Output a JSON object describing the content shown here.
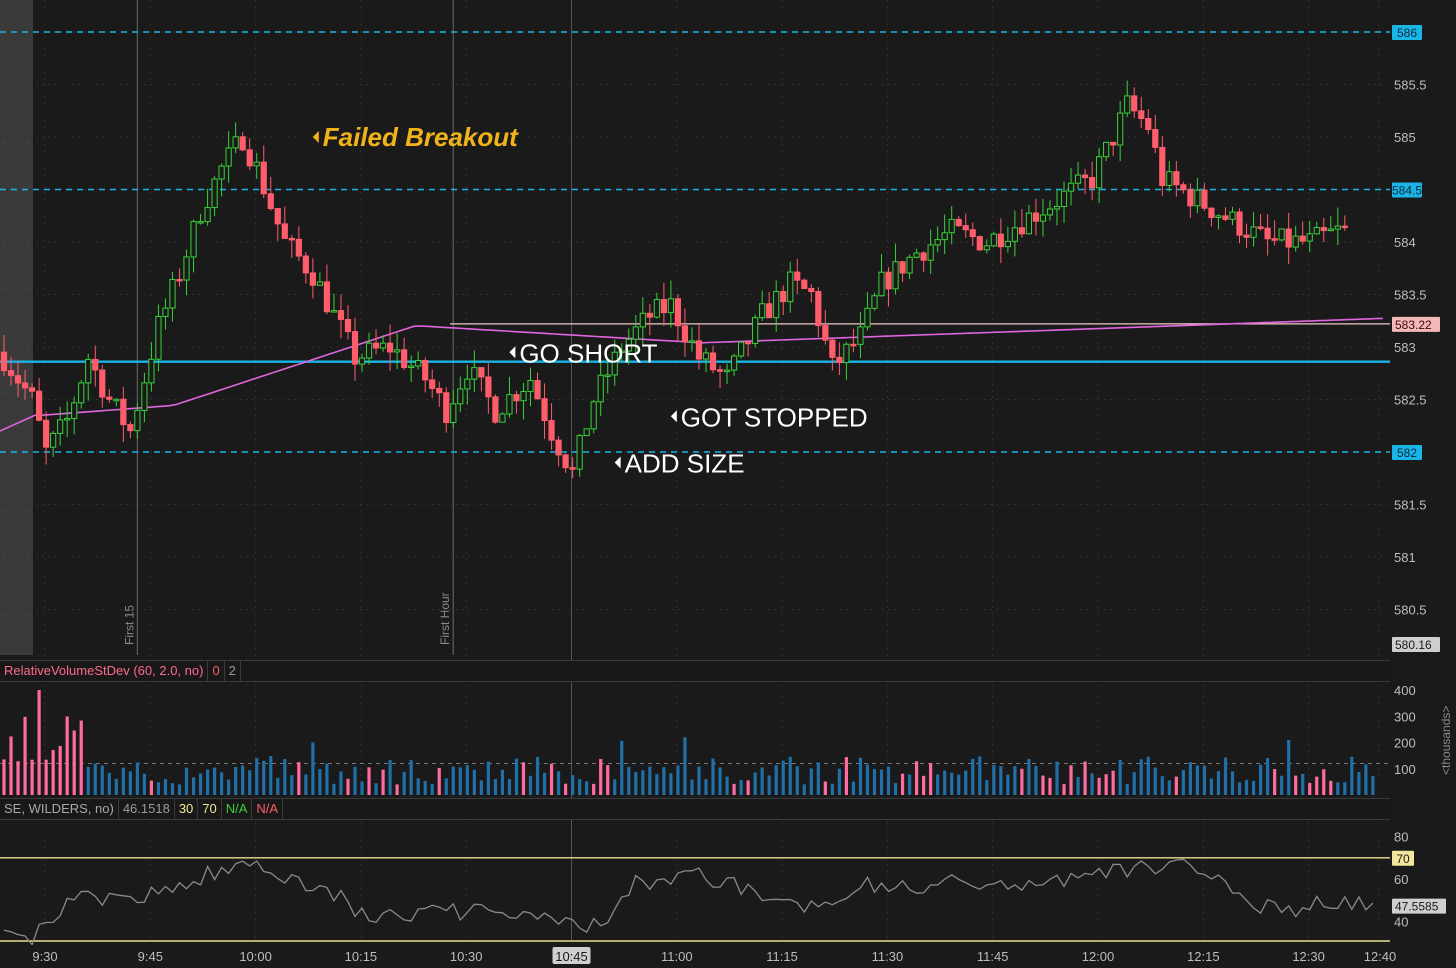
{
  "colors": {
    "background": "#1a1a1a",
    "grid": "#333333",
    "bull": "#3ad13a",
    "bear": "#ff5d6c",
    "level": "#19b5e6",
    "vwap": "#e066e0",
    "annotation": "#f0b418",
    "text": "#ffffff",
    "volume_normal": "#1f6fa8",
    "volume_high": "#ff6aa0",
    "rsi_line": "#8a8a8a",
    "rsi_band": "#e8e08a"
  },
  "price_axis": {
    "ticks": [
      "586",
      "585.5",
      "585",
      "584.5",
      "584",
      "583.5",
      "583",
      "582.5",
      "582",
      "581.5",
      "581",
      "580.5"
    ],
    "highlighted": [
      "586",
      "584.5",
      "582"
    ],
    "current_price": "583.22",
    "low_price": "580.16"
  },
  "levels": {
    "dashed": [
      586,
      584.5,
      582
    ],
    "solid": 582.86,
    "current": 583.22
  },
  "annotations": [
    {
      "text": "Failed Breakout",
      "style": "callout",
      "price": 585.0,
      "time": "10:09"
    },
    {
      "text": "GO SHORT",
      "style": "note",
      "price": 582.95,
      "time": "10:37"
    },
    {
      "text": "GOT STOPPED",
      "style": "note",
      "price": 582.34,
      "time": "11:00"
    },
    {
      "text": "ADD SIZE",
      "style": "note",
      "price": 581.9,
      "time": "10:52"
    }
  ],
  "session_markers": [
    {
      "label": "First 15",
      "time": "9:45"
    },
    {
      "label": "First Hour",
      "time": "10:30"
    }
  ],
  "time_axis": {
    "labels": [
      "9:30",
      "9:45",
      "10:00",
      "10:15",
      "10:30",
      "10:45",
      "11:00",
      "11:15",
      "11:30",
      "11:45",
      "12:00",
      "12:15",
      "12:30",
      "12:40"
    ],
    "highlighted": "10:45"
  },
  "volume_study": {
    "name": "RelativeVolumeStDev (60, 2.0, no)",
    "value1": "0",
    "value2": "2",
    "axis_ticks": [
      "400",
      "300",
      "200",
      "100"
    ],
    "unit_label": "<thousands>"
  },
  "rsi_study": {
    "name": "SE, WILDERS, no)",
    "value": "46.1518",
    "oversold": "30",
    "overbought": "70",
    "na_up": "N/A",
    "na_down": "N/A",
    "axis_ticks": [
      "80",
      "60",
      "40"
    ],
    "overbought_tag": "70",
    "current_tag": "47.5585"
  }
}
